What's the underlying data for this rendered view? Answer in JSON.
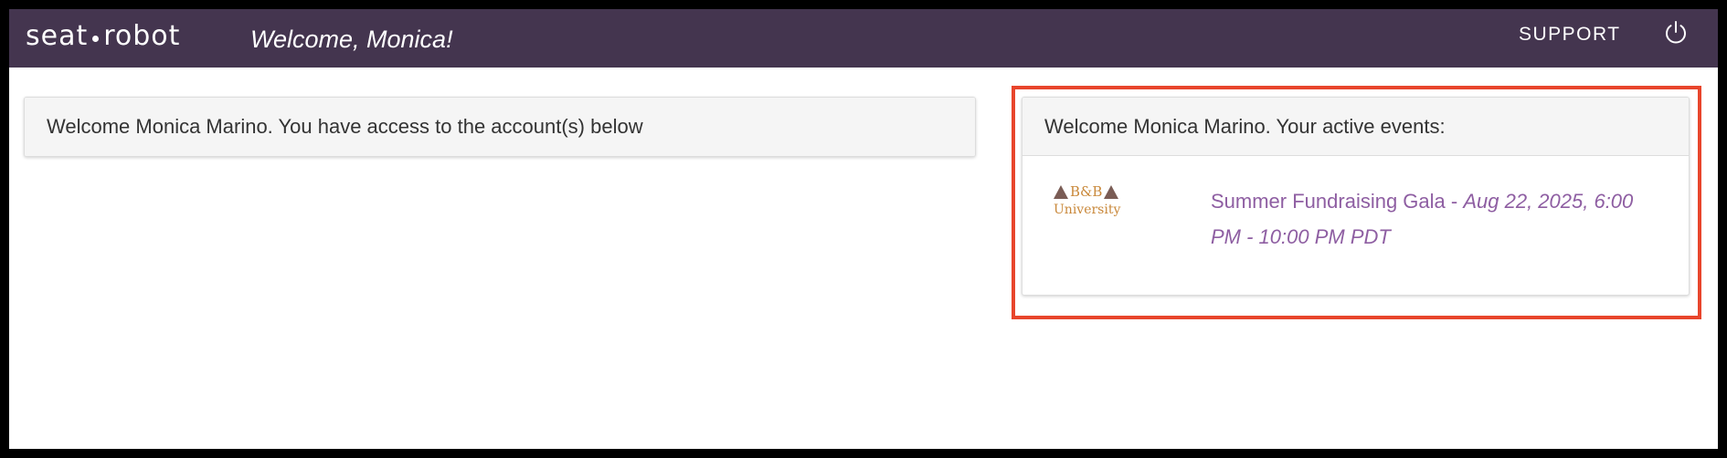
{
  "header": {
    "brand_left": "seat",
    "brand_right": "robot",
    "welcome": "Welcome, Monica!",
    "support_label": "SUPPORT",
    "power_icon": "power-icon"
  },
  "accounts_panel": {
    "heading": "Welcome Monica Marino. You have access to the account(s) below"
  },
  "events_panel": {
    "heading": "Welcome Monica Marino. Your active events:",
    "events": [
      {
        "logo_line1": "B&B",
        "logo_line2": "University",
        "name": "Summer Fundraising Gala",
        "separator": " - ",
        "date": "Aug 22, 2025, 6:00 PM - 10:00 PM PDT"
      }
    ]
  },
  "colors": {
    "topbar": "#44354f",
    "event_link": "#8e5ea2",
    "highlight": "#e8452c",
    "logo_gold": "#c9883a",
    "logo_brown": "#7a5c55"
  }
}
